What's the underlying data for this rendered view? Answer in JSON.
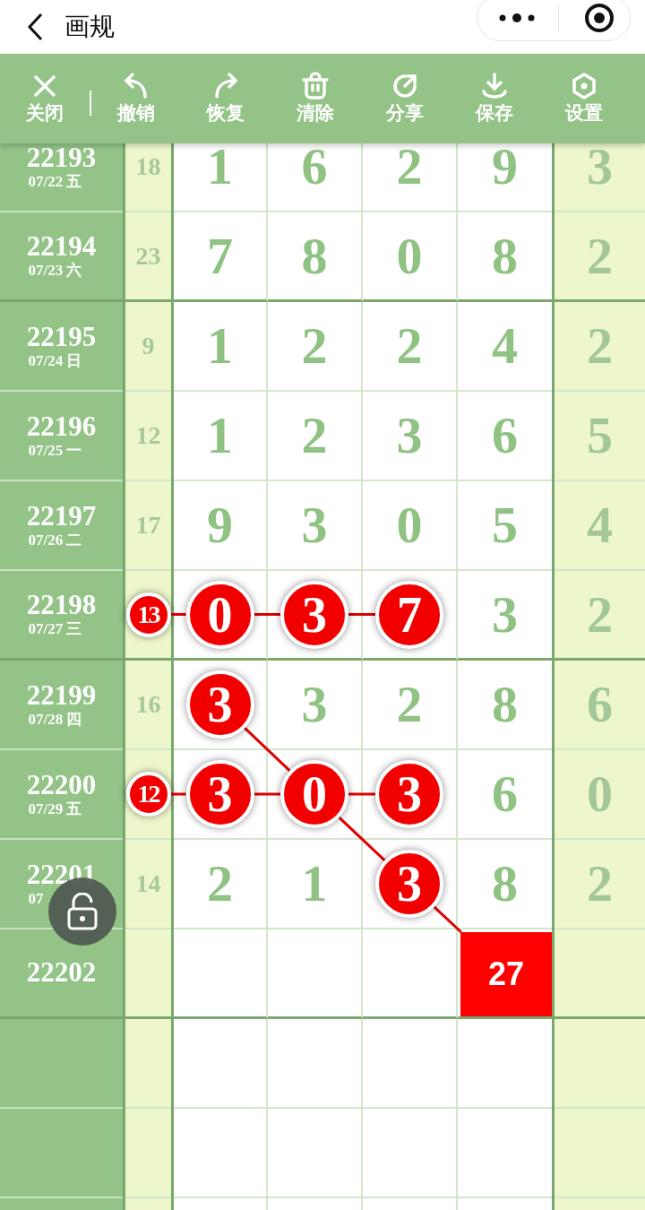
{
  "title_bar": {
    "title": "画规"
  },
  "toolbar": [
    {
      "kind": "close",
      "label": "关闭"
    },
    {
      "kind": "undo",
      "label": "撤销"
    },
    {
      "kind": "redo",
      "label": "恢复"
    },
    {
      "kind": "clear",
      "label": "清除"
    },
    {
      "kind": "share",
      "label": "分享"
    },
    {
      "kind": "save",
      "label": "保存"
    },
    {
      "kind": "settings",
      "label": "设置"
    }
  ],
  "rows": [
    {
      "issue": "22193",
      "date": "07/22 五",
      "group_end": false,
      "sum": {
        "text": "18",
        "kind": "plain"
      },
      "digits": [
        {
          "text": "1",
          "kind": "plain"
        },
        {
          "text": "6",
          "kind": "plain"
        },
        {
          "text": "2",
          "kind": "plain"
        },
        {
          "text": "9",
          "kind": "plain"
        }
      ],
      "tail": "3"
    },
    {
      "issue": "22194",
      "date": "07/23 六",
      "group_end": true,
      "sum": {
        "text": "23",
        "kind": "plain"
      },
      "digits": [
        {
          "text": "7",
          "kind": "plain"
        },
        {
          "text": "8",
          "kind": "plain"
        },
        {
          "text": "0",
          "kind": "plain"
        },
        {
          "text": "8",
          "kind": "plain"
        }
      ],
      "tail": "2"
    },
    {
      "issue": "22195",
      "date": "07/24 日",
      "group_end": false,
      "sum": {
        "text": "9",
        "kind": "plain"
      },
      "digits": [
        {
          "text": "1",
          "kind": "plain"
        },
        {
          "text": "2",
          "kind": "plain"
        },
        {
          "text": "2",
          "kind": "plain"
        },
        {
          "text": "4",
          "kind": "plain"
        }
      ],
      "tail": "2"
    },
    {
      "issue": "22196",
      "date": "07/25 一",
      "group_end": false,
      "sum": {
        "text": "12",
        "kind": "plain"
      },
      "digits": [
        {
          "text": "1",
          "kind": "plain"
        },
        {
          "text": "2",
          "kind": "plain"
        },
        {
          "text": "3",
          "kind": "plain"
        },
        {
          "text": "6",
          "kind": "plain"
        }
      ],
      "tail": "5"
    },
    {
      "issue": "22197",
      "date": "07/26 二",
      "group_end": false,
      "sum": {
        "text": "17",
        "kind": "plain"
      },
      "digits": [
        {
          "text": "9",
          "kind": "plain"
        },
        {
          "text": "3",
          "kind": "plain"
        },
        {
          "text": "0",
          "kind": "plain"
        },
        {
          "text": "5",
          "kind": "plain"
        }
      ],
      "tail": "4"
    },
    {
      "issue": "22198",
      "date": "07/27 三",
      "group_end": true,
      "sum": {
        "text": "13",
        "kind": "ball"
      },
      "digits": [
        {
          "text": "0",
          "kind": "ball"
        },
        {
          "text": "3",
          "kind": "ball"
        },
        {
          "text": "7",
          "kind": "ball"
        },
        {
          "text": "3",
          "kind": "plain"
        }
      ],
      "tail": "2"
    },
    {
      "issue": "22199",
      "date": "07/28 四",
      "group_end": false,
      "sum": {
        "text": "16",
        "kind": "plain"
      },
      "digits": [
        {
          "text": "3",
          "kind": "ball",
          "trend": true
        },
        {
          "text": "3",
          "kind": "plain"
        },
        {
          "text": "2",
          "kind": "plain"
        },
        {
          "text": "8",
          "kind": "plain"
        }
      ],
      "tail": "6"
    },
    {
      "issue": "22200",
      "date": "07/29 五",
      "group_end": false,
      "sum": {
        "text": "12",
        "kind": "ball"
      },
      "digits": [
        {
          "text": "3",
          "kind": "ball"
        },
        {
          "text": "0",
          "kind": "ball",
          "trend": true
        },
        {
          "text": "3",
          "kind": "ball"
        },
        {
          "text": "6",
          "kind": "plain"
        }
      ],
      "tail": "0"
    },
    {
      "issue": "22201",
      "date": "07",
      "group_end": false,
      "sum": {
        "text": "14",
        "kind": "plain"
      },
      "digits": [
        {
          "text": "2",
          "kind": "plain"
        },
        {
          "text": "1",
          "kind": "plain"
        },
        {
          "text": "3",
          "kind": "ball",
          "trend": true
        },
        {
          "text": "8",
          "kind": "plain"
        }
      ],
      "tail": "2"
    },
    {
      "issue": "22202",
      "group_end": true,
      "sum": {
        "kind": "empty"
      },
      "digits": [
        {
          "kind": "empty"
        },
        {
          "kind": "empty"
        },
        {
          "kind": "empty"
        },
        {
          "text": "27",
          "kind": "box",
          "trend": true
        }
      ]
    }
  ]
}
